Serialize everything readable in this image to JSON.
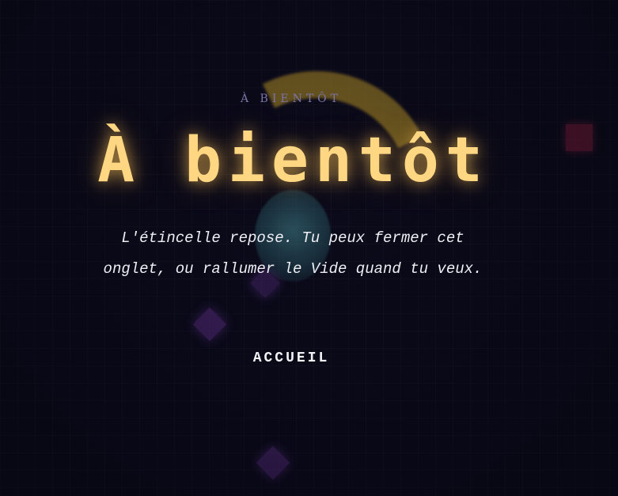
{
  "page": {
    "eyebrow": "À BIENTÔT",
    "title": "À bientôt",
    "message": "L'étincelle repose. Tu peux fermer cet onglet, ou rallumer le Vide quand tu veux.",
    "home_link_label": "ACCUEIL"
  },
  "colors": {
    "background": "#0b0a1a",
    "title": "#ffd782",
    "eyebrow": "#7b74a8",
    "text": "#eeeef4"
  },
  "decor": {
    "arc_icon": "glowing-arc-shape",
    "orb_icon": "teal-orb-shape",
    "diamond_icon": "purple-diamond-shape",
    "square_icon": "red-square-shape"
  }
}
